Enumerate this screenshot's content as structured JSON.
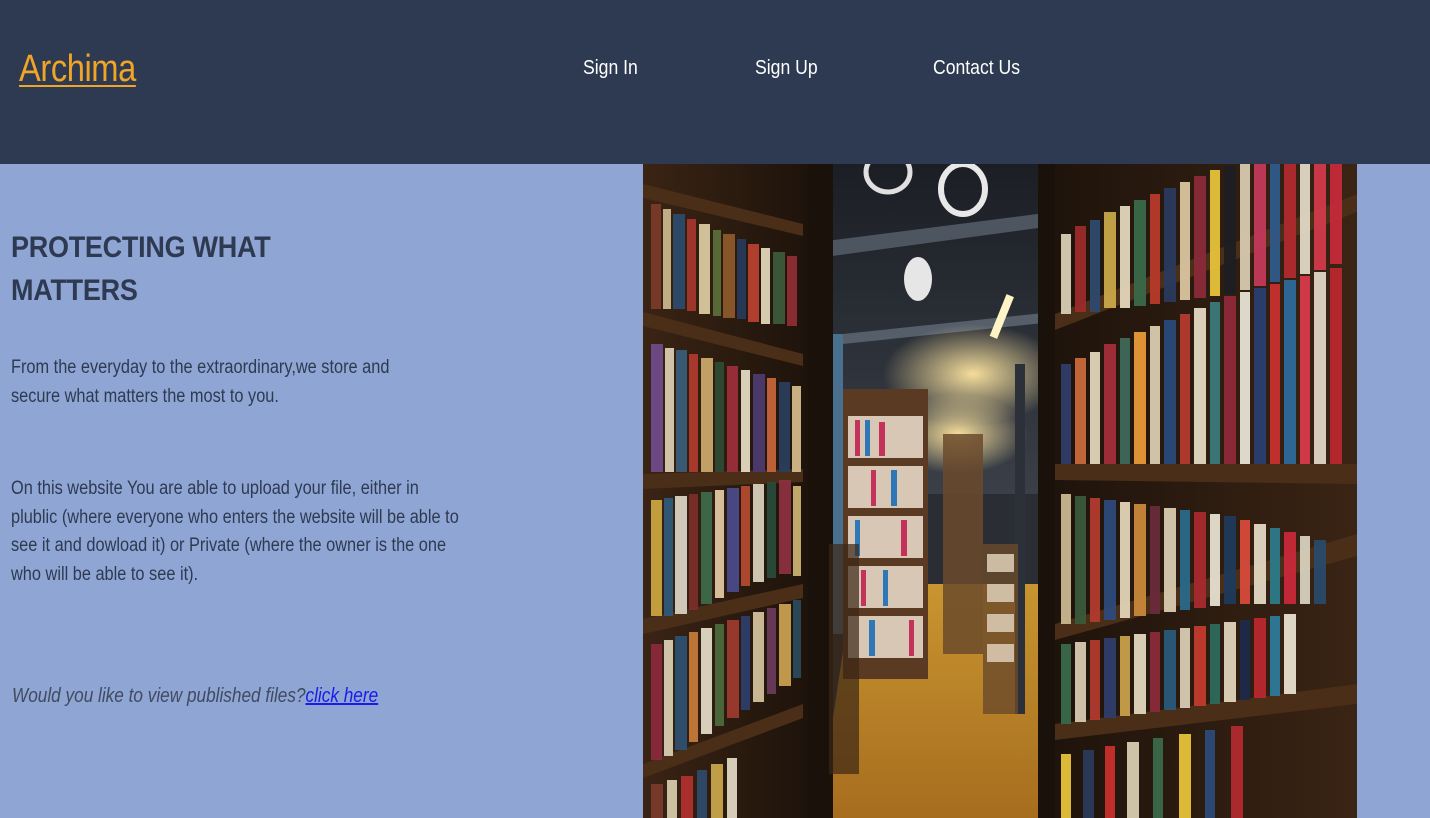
{
  "header": {
    "brand": "Archima",
    "nav": {
      "sign_in": "Sign In",
      "sign_up": "Sign Up",
      "contact": "Contact Us"
    }
  },
  "hero": {
    "headline": "PROTECTING WHAT MATTERS",
    "paragraph_1": "From the everyday to the extraordinary,we store and secure what matters the most to you.",
    "paragraph_2": "On this website You are able to upload your file, either in plublic (where everyone who enters the website will be able to see it and dowload it) or Private (where the owner is the one who will be able to see it).",
    "cta_question": "Would you like to view published files?",
    "cta_link": "click here"
  },
  "image": {
    "subject": "bookstore aisle with tall bookshelves"
  },
  "colors": {
    "header_bg": "#2e3a52",
    "page_bg": "#8fa5d3",
    "brand": "#f0a526",
    "link": "#1a1aee"
  }
}
